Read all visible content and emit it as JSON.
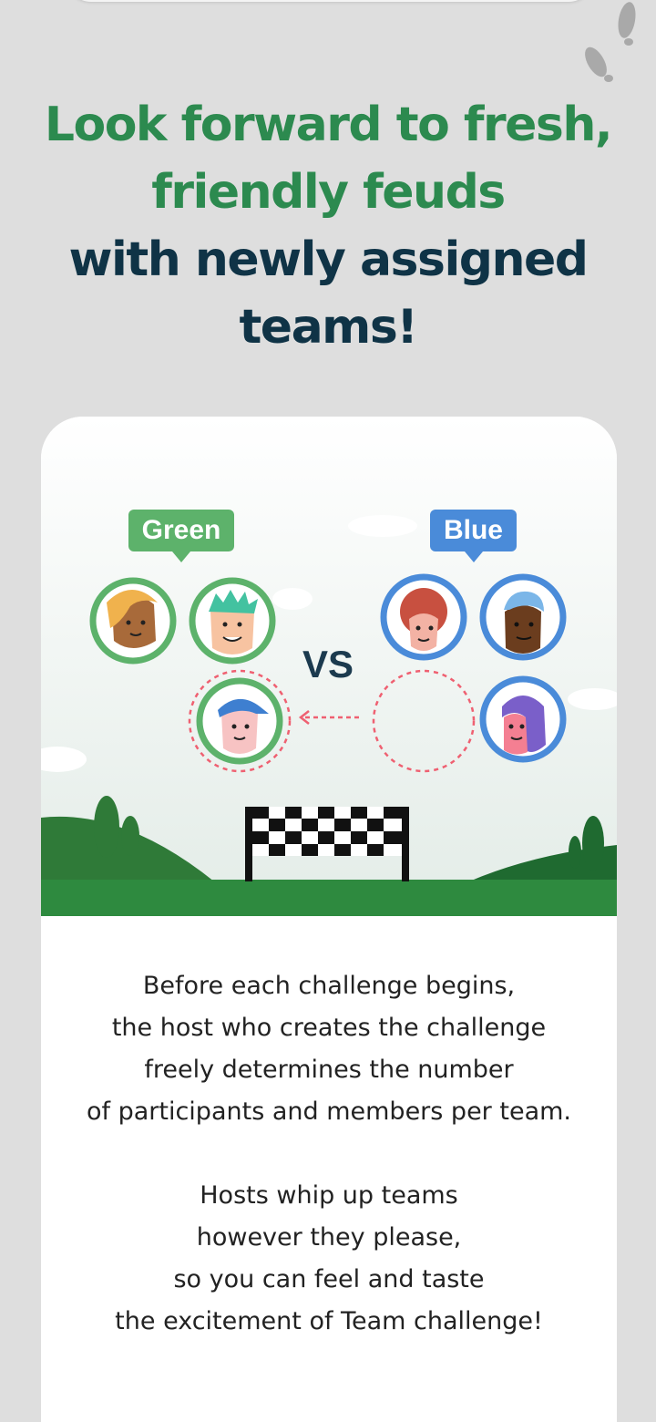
{
  "headline": {
    "line1": "Look forward to fresh,",
    "line2": "friendly feuds",
    "line3": "with newly assigned",
    "line4": "teams!"
  },
  "illustration": {
    "team_left_label": "Green",
    "team_right_label": "Blue",
    "versus_label": "VS",
    "colors": {
      "green": "#5db26b",
      "blue": "#4a8bd9",
      "dashed": "#ef6071"
    }
  },
  "body": {
    "paragraph1": [
      "Before each challenge begins,",
      "the host who creates the challenge",
      "freely determines the number",
      "of participants and members per team."
    ],
    "paragraph2": [
      "Hosts whip up teams",
      "however they please,",
      "so you can feel and taste",
      "the excitement of Team challenge!"
    ]
  }
}
